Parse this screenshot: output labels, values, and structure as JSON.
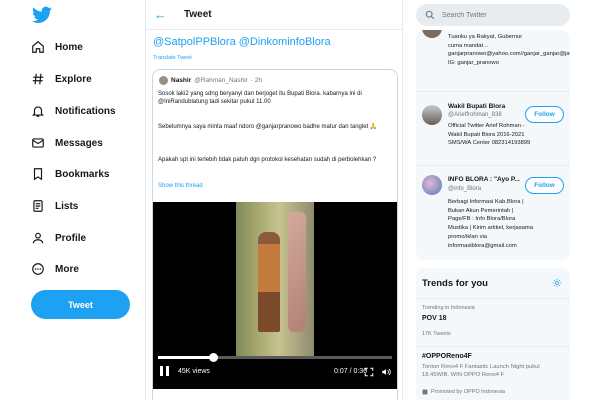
{
  "nav": {
    "items": [
      {
        "label": "Home",
        "icon": "home-icon"
      },
      {
        "label": "Explore",
        "icon": "hashtag-icon"
      },
      {
        "label": "Notifications",
        "icon": "bell-icon"
      },
      {
        "label": "Messages",
        "icon": "mail-icon"
      },
      {
        "label": "Bookmarks",
        "icon": "bookmark-icon"
      },
      {
        "label": "Lists",
        "icon": "list-icon"
      },
      {
        "label": "Profile",
        "icon": "person-icon"
      },
      {
        "label": "More",
        "icon": "more-circle-icon"
      }
    ],
    "tweet_button": "Tweet"
  },
  "header": {
    "title": "Tweet"
  },
  "tweet": {
    "mentions": "@SatpolPPBlora @DinkominfoBlora",
    "translate": "Translate Tweet",
    "quote": {
      "name": "Nashir",
      "handle": "@Rahman_Nashir",
      "time": "· 2h",
      "text1": "Sosok laki2 yang sdng beryanyi dan berjoget itu Bupati Blora. kabarnya ini di @IniRandublatung tadi sekitar pukul 11.00",
      "text2": "Sebelumnya saya minta maaf ndoro @ganjarpranowo badhe matur dan tanglet 🙏",
      "text3": "Apakah spt ini terlebih tidak patuh dgn protokol kesehatan sudah di perbolehkan ?",
      "show_thread": "Show this thread"
    },
    "video": {
      "views": "45K views",
      "time": "0:07 / 0:30",
      "progress": 0.233
    }
  },
  "search": {
    "placeholder": "Search Twitter"
  },
  "who_to_follow": {
    "accounts": [
      {
        "bio": "Tuanku ya Rakyat, Gubernur cuma mandat .. ganjarpranowo@yahoo.com//ganjar_ganjar@jatengprov.go.id// IG: ganjar_pranowo"
      },
      {
        "name": "Wakil Bupati Blora",
        "handle": "@Arieffrohman_838",
        "bio": "Official Twitter Arief Rohman - Wakil Bupati Blora 2016-2021 SMS/WA Center 082314193899",
        "follow": "Follow"
      },
      {
        "name": "INFO BLORA : \"Ayo P...",
        "handle": "@info_Blora",
        "bio": "Berbagi Informasi Kab.Blora | Bukan Akun Pemerintah | Page/FB : Info Blora/Blora Mustika | Kirim artikel, kerjasama promo/iklan via informasiblora@gmail.com",
        "follow": "Follow"
      }
    ]
  },
  "trends": {
    "title": "Trends for you",
    "items": [
      {
        "context": "Trending in Indonesia",
        "name": "POV 18",
        "count": "17K Tweets"
      },
      {
        "name": "#OPPOReno4F",
        "desc": "Tonton Reno4 F Fantastic Launch Night pukul 18.45WIB. WIN OPPO Reno4 F",
        "promo": "Promoted by OPPO Indonesia"
      }
    ]
  },
  "colors": {
    "accent": "#1da1f2",
    "text": "#14171a",
    "secondary": "#657786"
  }
}
